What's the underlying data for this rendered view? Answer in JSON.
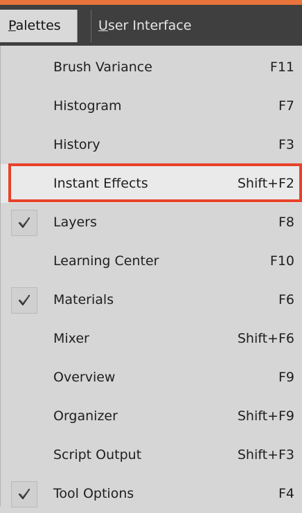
{
  "menubar": {
    "active_menu": "Palettes",
    "active_accel": "P",
    "active_rest": "alettes",
    "other_menu": "User Interface",
    "other_accel": "U",
    "other_rest": "ser Interface"
  },
  "menu": {
    "items": [
      {
        "label": "Brush Variance",
        "shortcut": "F11",
        "checked": false
      },
      {
        "label": "Histogram",
        "shortcut": "F7",
        "checked": false
      },
      {
        "label": "History",
        "shortcut": "F3",
        "checked": false
      },
      {
        "label": "Instant Effects",
        "shortcut": "Shift+F2",
        "checked": false,
        "highlighted": true
      },
      {
        "label": "Layers",
        "shortcut": "F8",
        "checked": true
      },
      {
        "label": "Learning Center",
        "shortcut": "F10",
        "checked": false
      },
      {
        "label": "Materials",
        "shortcut": "F6",
        "checked": true
      },
      {
        "label": "Mixer",
        "shortcut": "Shift+F6",
        "checked": false
      },
      {
        "label": "Overview",
        "shortcut": "F9",
        "checked": false
      },
      {
        "label": "Organizer",
        "shortcut": "Shift+F9",
        "checked": false
      },
      {
        "label": "Script Output",
        "shortcut": "Shift+F3",
        "checked": false
      },
      {
        "label": "Tool Options",
        "shortcut": "F4",
        "checked": true
      }
    ]
  },
  "colors": {
    "accent": "#e8743b",
    "highlight_border": "#e8412a",
    "menubar_bg": "#3f3f3f",
    "menu_bg": "#d6d6d6"
  }
}
